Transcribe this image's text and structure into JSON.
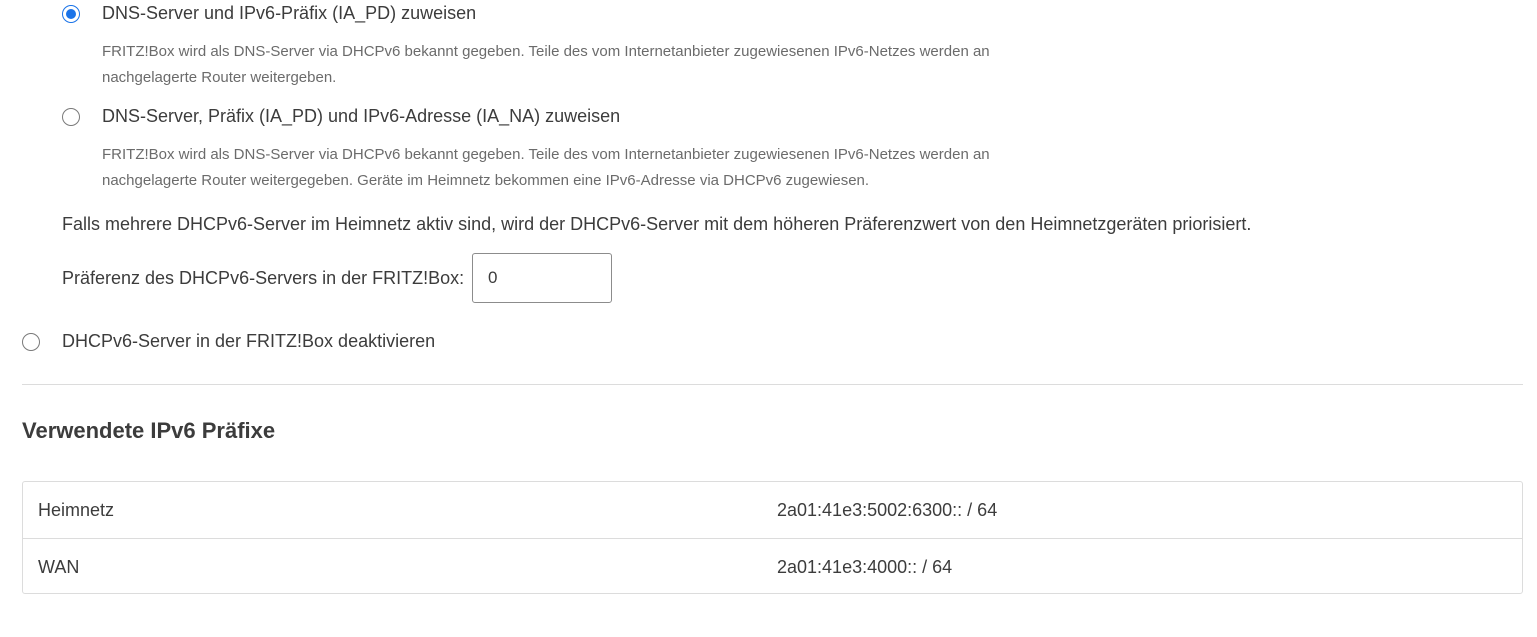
{
  "dhcpv6_options": [
    {
      "label": "DNS-Server und IPv6-Präfix (IA_PD) zuweisen",
      "selected": true,
      "description_line1": "FRITZ!Box wird als DNS-Server via DHCPv6 bekannt gegeben. Teile des vom Internetanbieter zugewiesenen IPv6-Netzes werden an",
      "description_line2": "nachgelagerte Router weitergeben."
    },
    {
      "label": "DNS-Server, Präfix (IA_PD) und IPv6-Adresse (IA_NA) zuweisen",
      "selected": false,
      "description_line1": "FRITZ!Box wird als DNS-Server via DHCPv6 bekannt gegeben. Teile des vom Internetanbieter zugewiesenen IPv6-Netzes werden an",
      "description_line2": "nachgelagerte Router weitergegeben. Geräte im Heimnetz bekommen eine IPv6-Adresse via DHCPv6 zugewiesen."
    }
  ],
  "preference": {
    "info": "Falls mehrere DHCPv6-Server im Heimnetz aktiv sind, wird der DHCPv6-Server mit dem höheren Präferenzwert von den Heimnetzgeräten priorisiert.",
    "label": "Präferenz des DHCPv6-Servers in der FRITZ!Box:",
    "value": "0"
  },
  "disable_option": {
    "label": "DHCPv6-Server in der FRITZ!Box deaktivieren",
    "selected": false
  },
  "prefixes": {
    "heading": "Verwendete IPv6 Präfixe",
    "rows": [
      {
        "name": "Heimnetz",
        "prefix": "2a01:41e3:5002:6300:: / 64"
      },
      {
        "name": "WAN",
        "prefix": "2a01:41e3:4000:: / 64"
      }
    ]
  },
  "colors": {
    "accent": "#1a73e8",
    "text": "#3c3c3c",
    "muted_text": "#6b6b6b",
    "border": "#dcdcdc"
  }
}
